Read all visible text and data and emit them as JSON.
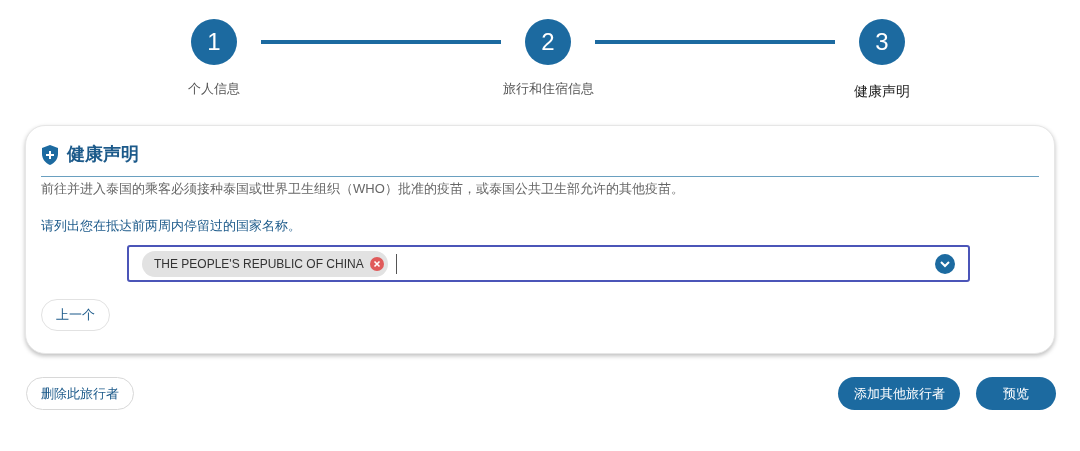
{
  "steps": [
    {
      "number": "1",
      "label": "个人信息",
      "selected": false
    },
    {
      "number": "2",
      "label": "旅行和住宿信息",
      "selected": false
    },
    {
      "number": "3",
      "label": "健康声明",
      "selected": true
    }
  ],
  "section": {
    "title": "健康声明",
    "notice": "前往并进入泰国的乘客必须接种泰国或世界卫生组织（WHO）批准的疫苗，或泰国公共卫生部允许的其他疫苗。",
    "question": "请列出您在抵达前两周内停留过的国家名称。",
    "selected_countries": [
      "THE PEOPLE'S REPUBLIC OF CHINA"
    ],
    "back_button": "上一个"
  },
  "actions": {
    "remove": "删除此旅行者",
    "add": "添加其他旅行者",
    "preview": "预览"
  }
}
